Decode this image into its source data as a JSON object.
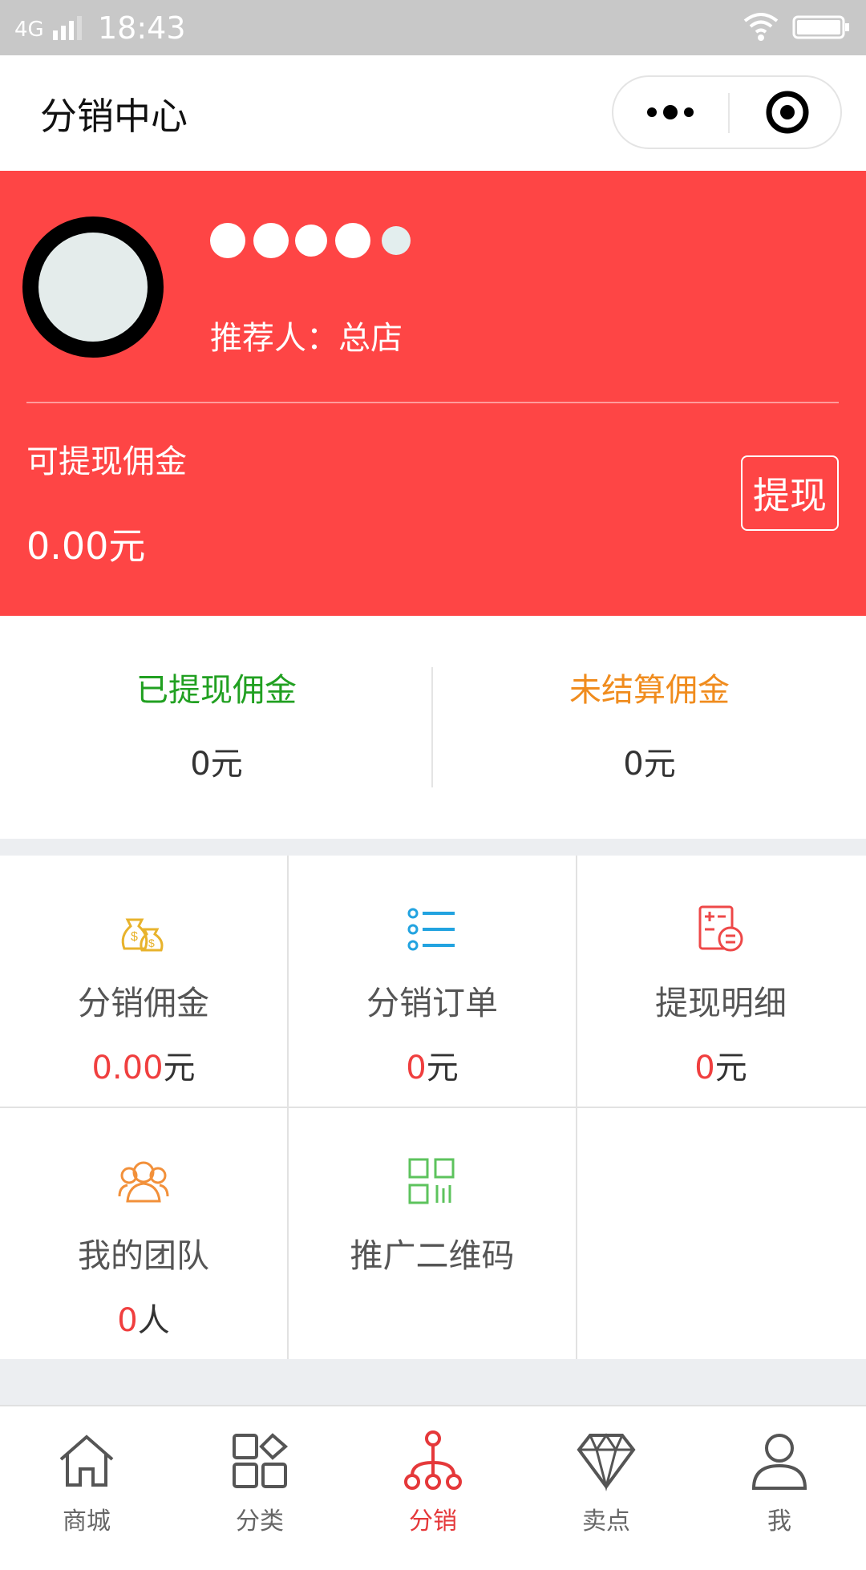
{
  "status_bar": {
    "network": "4G",
    "time": "18:43"
  },
  "nav": {
    "title": "分销中心"
  },
  "profile": {
    "nickname_masked": "●●●●●",
    "referrer": "推荐人：总店"
  },
  "withdrawable": {
    "label": "可提现佣金",
    "amount": "0.00元",
    "button_label": "提现"
  },
  "summary": {
    "withdrawn": {
      "label": "已提现佣金",
      "value": "0元",
      "color": "#21a021"
    },
    "unsettled": {
      "label": "未结算佣金",
      "value": "0元",
      "color": "#f08c1e"
    }
  },
  "grid": {
    "commission": {
      "label": "分销佣金",
      "num": "0.00",
      "unit": "元",
      "icon": "money-bag-icon"
    },
    "orders": {
      "label": "分销订单",
      "num": "0",
      "unit": "元",
      "icon": "list-icon"
    },
    "withdraw_detail": {
      "label": "提现明细",
      "num": "0",
      "unit": "元",
      "icon": "receipt-icon"
    },
    "team": {
      "label": "我的团队",
      "num": "0",
      "unit": "人",
      "icon": "team-icon"
    },
    "qrcode": {
      "label": "推广二维码",
      "icon": "qrcode-icon"
    }
  },
  "tabs": [
    {
      "label": "商城",
      "icon": "home-icon"
    },
    {
      "label": "分类",
      "icon": "category-icon"
    },
    {
      "label": "分销",
      "icon": "distribution-icon",
      "active": true
    },
    {
      "label": "卖点",
      "icon": "diamond-icon"
    },
    {
      "label": "我",
      "icon": "user-icon"
    }
  ],
  "colors": {
    "hero_red": "#fe4545",
    "accent_red": "#e5383a"
  }
}
